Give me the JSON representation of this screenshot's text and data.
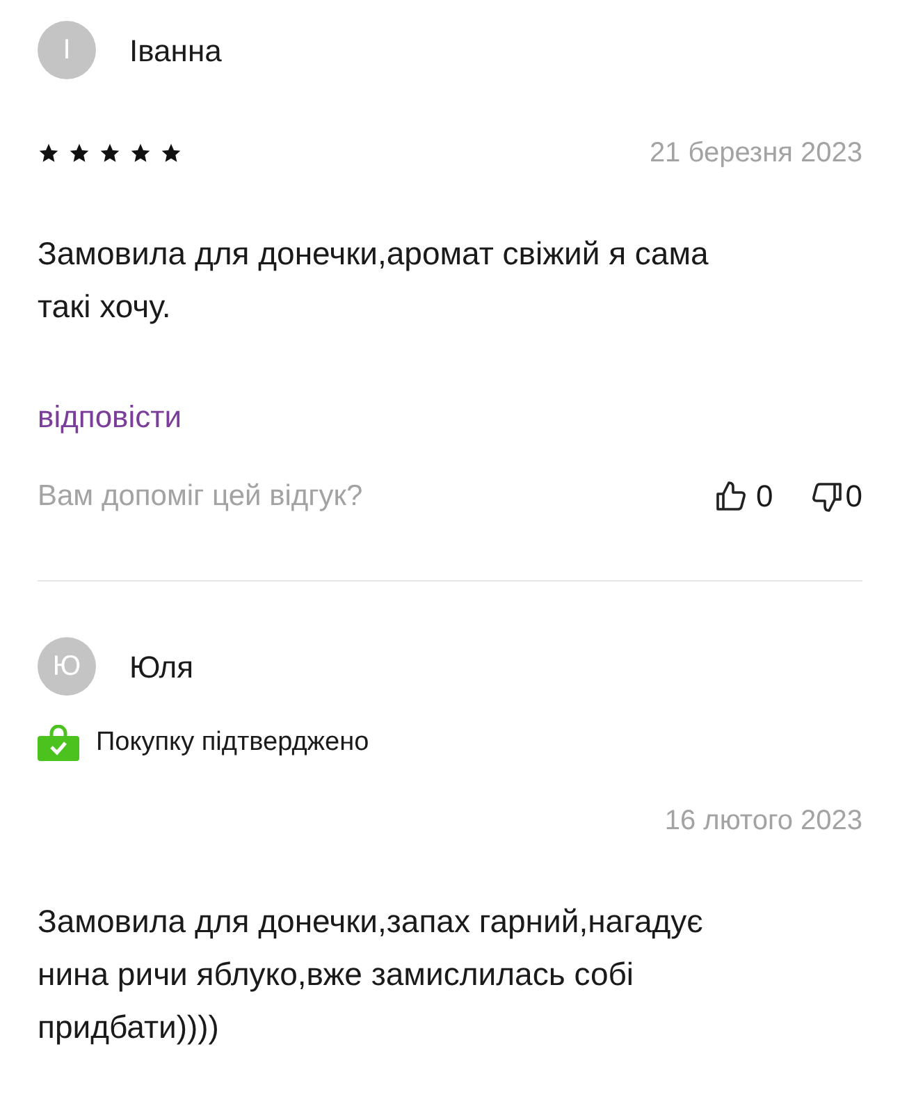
{
  "reviews": [
    {
      "avatar_letter": "І",
      "author": "Іванна",
      "verified": false,
      "stars": 5,
      "date": "21 березня 2023",
      "text": "Замовила для донечки,аромат свіжий я сама такі хочу.",
      "reply_link": "відповісти",
      "helpful": {
        "question": "Вам допоміг цей відгук?",
        "likes": "0",
        "dislikes": "0"
      }
    },
    {
      "avatar_letter": "Ю",
      "author": "Юля",
      "verified": true,
      "verified_label": "Покупку підтверджено",
      "date": "16 лютого 2023",
      "text": "Замовила для донечки,запах гарний,нагадує нина ричи яблуко,вже замислилась собі придбати))))"
    }
  ]
}
